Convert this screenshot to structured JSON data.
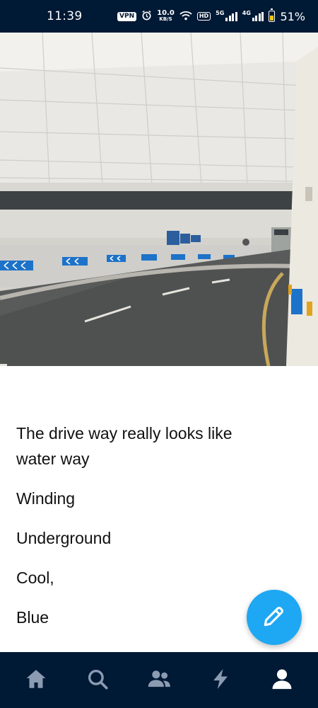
{
  "status_bar": {
    "time": "11:39",
    "vpn": "VPN",
    "speed_value": "10.0",
    "speed_unit": "KB/S",
    "hd": "HD",
    "network_1": "5G",
    "network_2": "4G",
    "battery_percent": "51%",
    "battery_level": 0.51
  },
  "post": {
    "photo_description_icon": "parking-garage-photo",
    "lines": [
      "The drive way really looks like water way",
      "Winding",
      "Underground",
      "Cool,",
      "Blue"
    ]
  },
  "fab": {
    "icon": "pencil-icon"
  },
  "bottom_nav": {
    "items": [
      {
        "icon": "home-icon"
      },
      {
        "icon": "search-icon"
      },
      {
        "icon": "people-icon"
      },
      {
        "icon": "lightning-icon"
      },
      {
        "icon": "account-icon"
      }
    ]
  },
  "colors": {
    "nav_background": "#001935",
    "fab_background": "#1ea7f2",
    "nav_icon": "#8a9bb2",
    "nav_icon_active": "#ffffff"
  }
}
